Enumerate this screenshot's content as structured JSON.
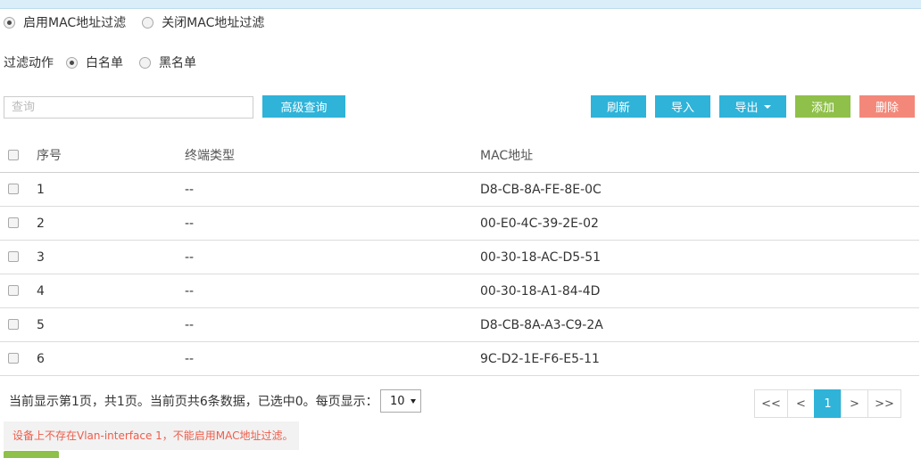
{
  "mac_filter": {
    "options": [
      {
        "label": "启用MAC地址过滤",
        "checked": true
      },
      {
        "label": "关闭MAC地址过滤",
        "checked": false
      }
    ]
  },
  "filter_action": {
    "label": "过滤动作",
    "options": [
      {
        "label": "白名单",
        "checked": true
      },
      {
        "label": "黑名单",
        "checked": false
      }
    ]
  },
  "search": {
    "placeholder": "查询"
  },
  "toolbar": {
    "advanced_query": "高级查询",
    "refresh": "刷新",
    "import": "导入",
    "export": "导出",
    "add": "添加",
    "delete": "删除"
  },
  "table": {
    "headers": {
      "no": "序号",
      "type": "终端类型",
      "mac": "MAC地址"
    },
    "rows": [
      {
        "no": "1",
        "type": "--",
        "mac": "D8-CB-8A-FE-8E-0C"
      },
      {
        "no": "2",
        "type": "--",
        "mac": "00-E0-4C-39-2E-02"
      },
      {
        "no": "3",
        "type": "--",
        "mac": "00-30-18-AC-D5-51"
      },
      {
        "no": "4",
        "type": "--",
        "mac": "00-30-18-A1-84-4D"
      },
      {
        "no": "5",
        "type": "--",
        "mac": "D8-CB-8A-A3-C9-2A"
      },
      {
        "no": "6",
        "type": "--",
        "mac": "9C-D2-1E-F6-E5-11"
      }
    ]
  },
  "pager": {
    "summary": "当前显示第1页，共1页。当前页共6条数据，已选中0。每页显示：",
    "page_size": "10",
    "first": "<<",
    "prev": "<",
    "current": "1",
    "next": ">",
    "last": ">>"
  },
  "error_message": "设备上不存在Vlan-interface 1，不能启用MAC地址过滤。",
  "colors": {
    "blue": "#2fb3d9",
    "green": "#8fc04a",
    "red": "#f3887a",
    "error_text": "#ee5d4b"
  }
}
